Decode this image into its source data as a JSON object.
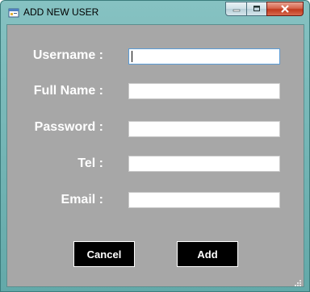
{
  "window": {
    "title": "ADD NEW USER"
  },
  "form": {
    "username_label": "Username :",
    "fullname_label": "Full Name :",
    "password_label": "Password :",
    "tel_label": "Tel :",
    "email_label": "Email :",
    "username_value": "",
    "fullname_value": "",
    "password_value": "",
    "tel_value": "",
    "email_value": ""
  },
  "buttons": {
    "cancel_label": "Cancel",
    "add_label": "Add"
  },
  "icons": {
    "app": "form-icon",
    "minimize": "minimize-icon",
    "maximize": "maximize-icon",
    "close": "close-icon",
    "resize": "resize-grip-icon"
  }
}
